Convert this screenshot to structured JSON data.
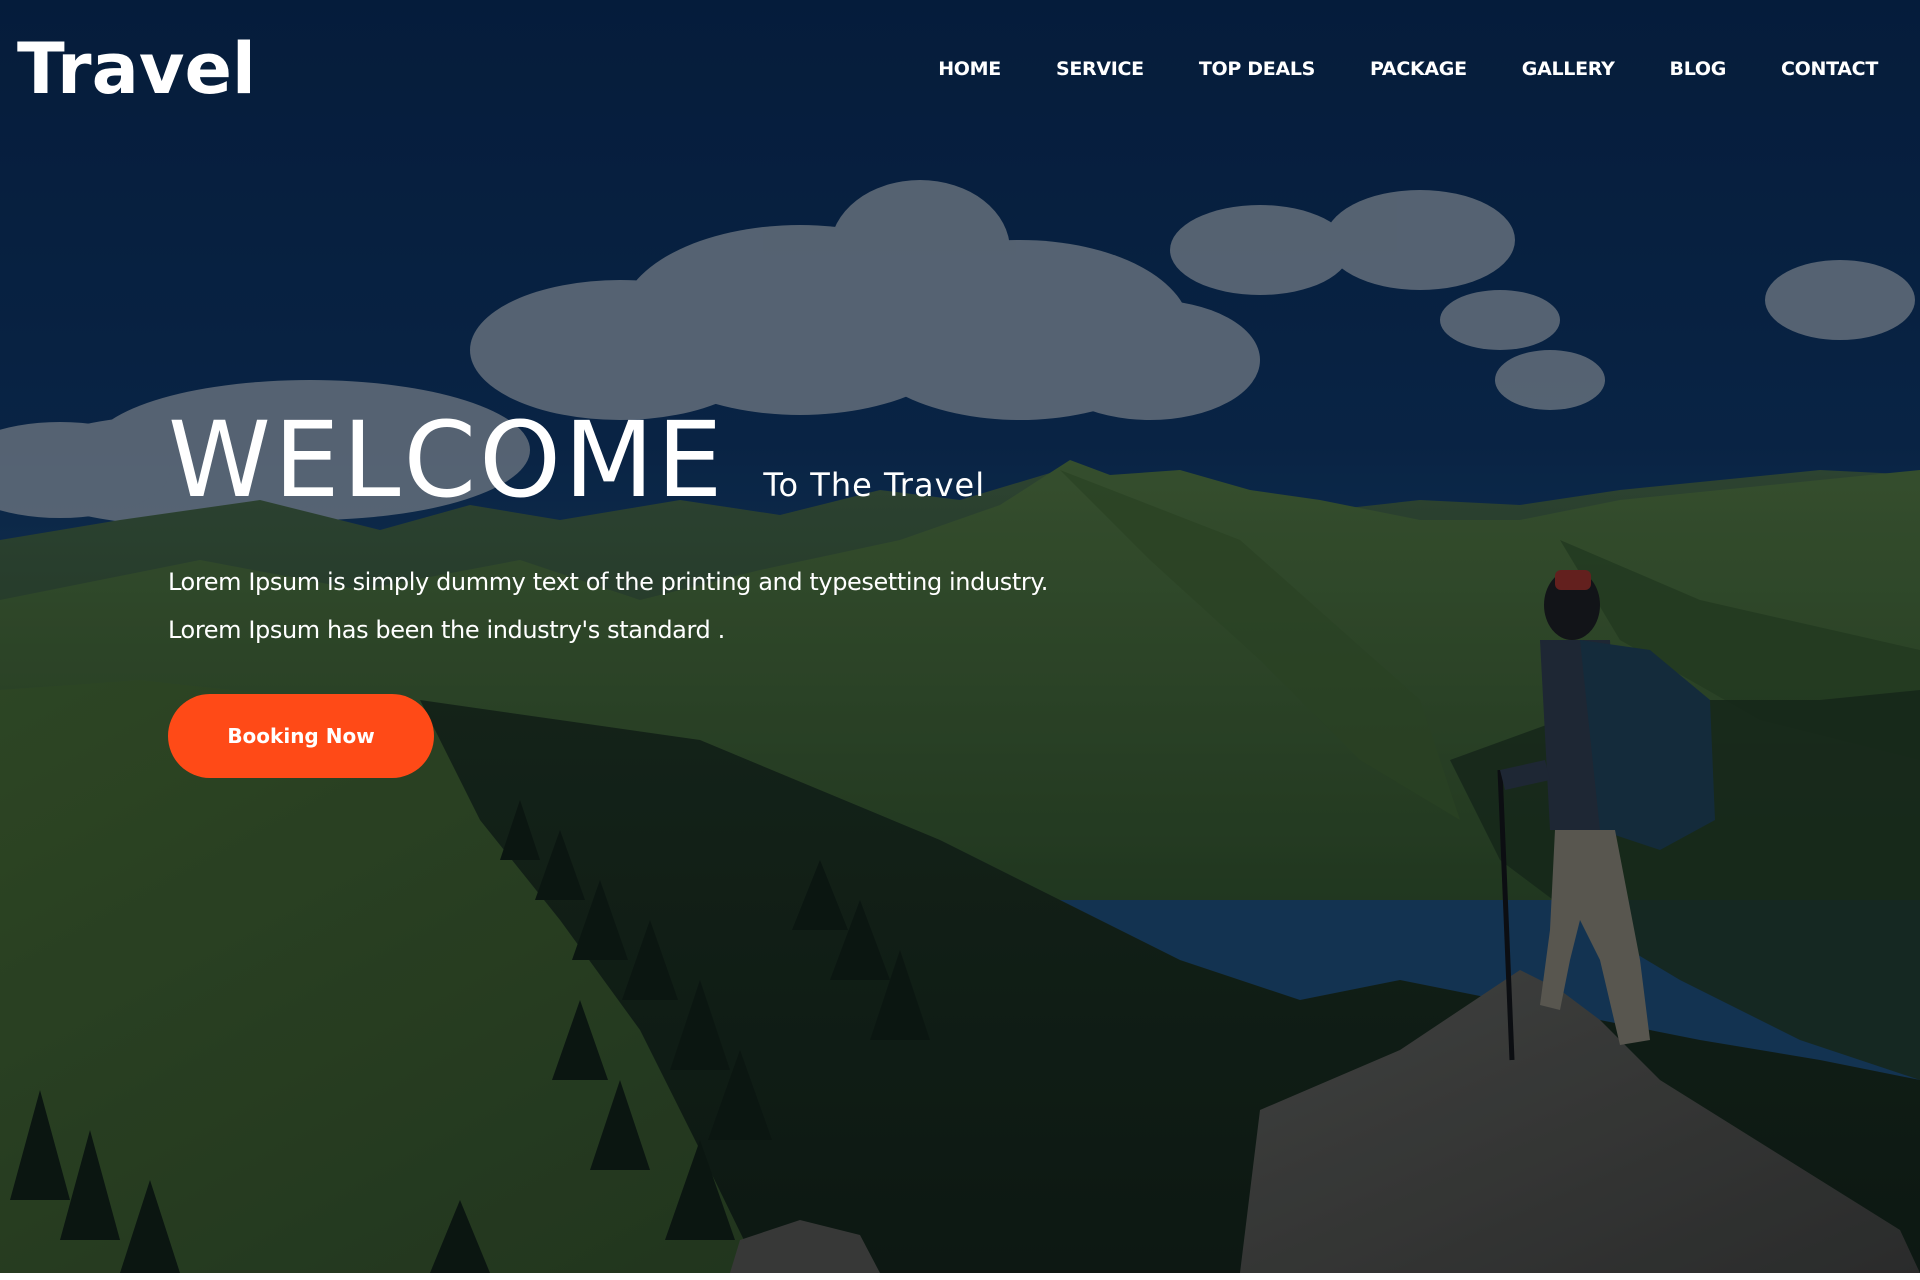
{
  "brand": {
    "logo": "Travel"
  },
  "nav": {
    "items": [
      {
        "label": "HOME"
      },
      {
        "label": "SERVICE"
      },
      {
        "label": "TOP DEALS"
      },
      {
        "label": "PACKAGE"
      },
      {
        "label": "GALLERY"
      },
      {
        "label": "BLOG"
      },
      {
        "label": "CONTACT"
      }
    ]
  },
  "hero": {
    "title": "WELCOME",
    "subtitle": "To The Travel",
    "line1": "Lorem Ipsum is simply dummy text of the printing and typesetting industry.",
    "line2": "Lorem Ipsum has been the industry's standard .",
    "cta_label": "Booking Now"
  },
  "colors": {
    "accent": "#ff4a17",
    "sky_dark": "#0a2a4e",
    "sky_mid": "#17406b",
    "text": "#ffffff"
  }
}
